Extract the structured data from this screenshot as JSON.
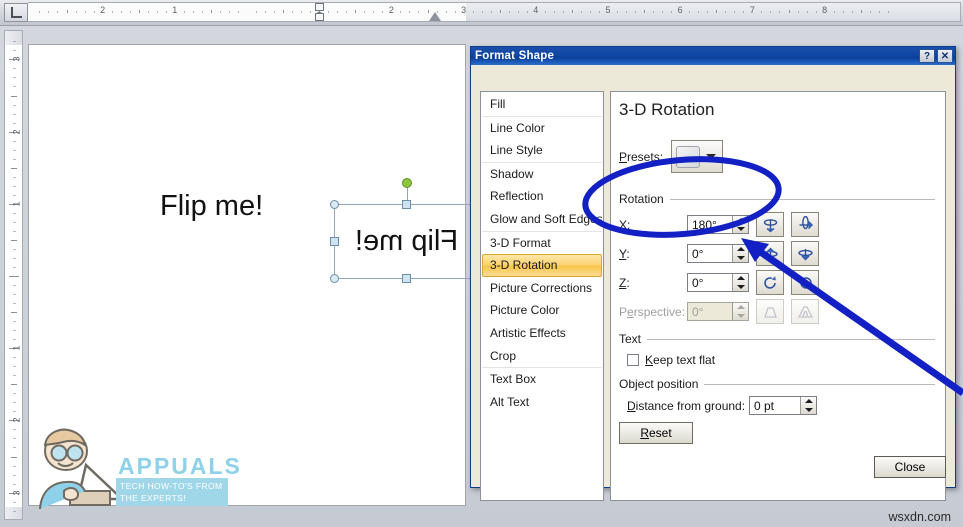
{
  "app": {
    "ruler": {
      "horizontal_labels": [
        "2",
        "1",
        "1",
        "2",
        "3",
        "4",
        "5"
      ],
      "vertical_labels": [
        "1",
        "1",
        "1",
        "2",
        "3"
      ]
    }
  },
  "slide": {
    "plain_text": "Flip me!",
    "flipped_text": "Flip me!"
  },
  "dialog": {
    "title": "Format Shape",
    "help_button": "?",
    "close_button": "✕",
    "nav": [
      {
        "label": "Fill",
        "selected": false,
        "separator_before": false
      },
      {
        "label": "Line Color",
        "selected": false,
        "separator_before": true
      },
      {
        "label": "Line Style",
        "selected": false,
        "separator_before": false
      },
      {
        "label": "Shadow",
        "selected": false,
        "separator_before": true
      },
      {
        "label": "Reflection",
        "selected": false,
        "separator_before": false
      },
      {
        "label": "Glow and Soft Edges",
        "selected": false,
        "separator_before": false
      },
      {
        "label": "3-D Format",
        "selected": false,
        "separator_before": true
      },
      {
        "label": "3-D Rotation",
        "selected": true,
        "separator_before": false
      },
      {
        "label": "Picture Corrections",
        "selected": false,
        "separator_before": false
      },
      {
        "label": "Picture Color",
        "selected": false,
        "separator_before": false
      },
      {
        "label": "Artistic Effects",
        "selected": false,
        "separator_before": false
      },
      {
        "label": "Crop",
        "selected": false,
        "separator_before": false
      },
      {
        "label": "Text Box",
        "selected": false,
        "separator_before": true
      },
      {
        "label": "Alt Text",
        "selected": false,
        "separator_before": false
      }
    ],
    "panel": {
      "title": "3-D Rotation",
      "presets_label": "Presets:",
      "groups": {
        "rotation": "Rotation",
        "text": "Text",
        "object_position": "Object position"
      },
      "fields": {
        "x_label": "X:",
        "x_value": "180°",
        "y_label": "Y:",
        "y_value": "0°",
        "z_label": "Z:",
        "z_value": "0°",
        "perspective_label": "Perspective:",
        "perspective_value": "0°",
        "keep_text_flat_label": "Keep text flat",
        "keep_text_flat_checked": false,
        "distance_label": "Distance from ground:",
        "distance_value": "0 pt"
      },
      "reset_label": "Reset"
    },
    "close_label": "Close"
  },
  "watermarks": {
    "appuals_name": "APPUALS",
    "appuals_tagline": "TECH HOW-TO'S FROM THE EXPERTS!",
    "site": "wsxdn.com"
  },
  "colors": {
    "annotation_blue": "#1220c4",
    "title_blue": "#0f47a1",
    "selection_amber": "#f7c548",
    "rotate_handle_green": "#8cc63e"
  }
}
